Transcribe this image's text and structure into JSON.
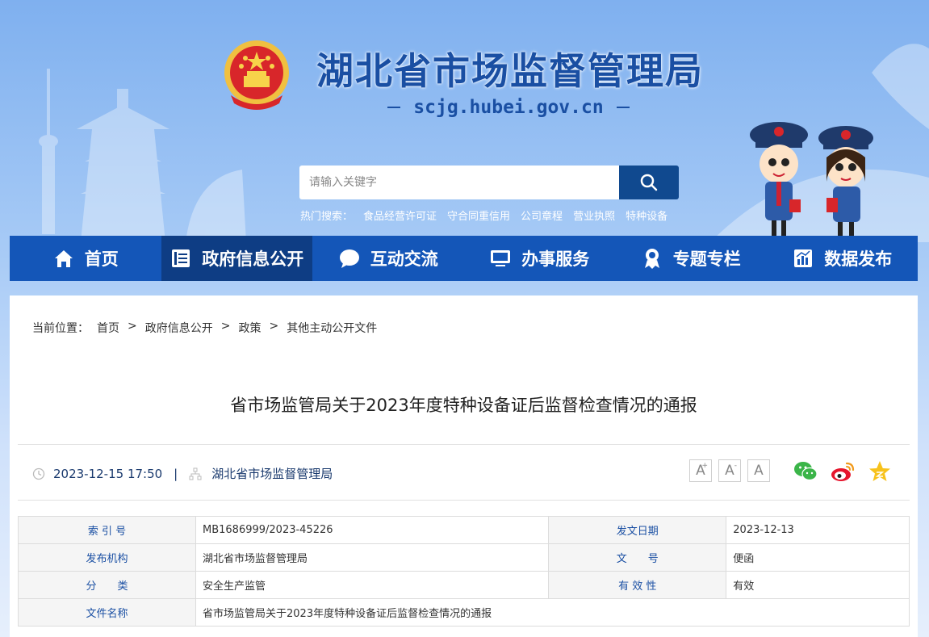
{
  "header": {
    "site_title": "湖北省市场监督管理局",
    "site_domain": "scjg.hubei.gov.cn"
  },
  "search": {
    "placeholder": "请输入关键字",
    "hot_label": "热门搜索：",
    "hot_terms": [
      "食品经营许可证",
      "守合同重信用",
      "公司章程",
      "营业执照",
      "特种设备"
    ]
  },
  "nav": {
    "items": [
      {
        "label": "首页",
        "icon": "home-icon"
      },
      {
        "label": "政府信息公开",
        "icon": "document-icon"
      },
      {
        "label": "互动交流",
        "icon": "chat-bubble-icon"
      },
      {
        "label": "办事服务",
        "icon": "monitor-icon"
      },
      {
        "label": "专题专栏",
        "icon": "award-icon"
      },
      {
        "label": "数据发布",
        "icon": "chart-icon"
      }
    ],
    "active_index": 1
  },
  "breadcrumb": {
    "prefix": "当前位置：",
    "items": [
      "首页",
      "政府信息公开",
      "政策",
      "其他主动公开文件"
    ],
    "separator": ">"
  },
  "article": {
    "title": "省市场监管局关于2023年度特种设备证后监督检查情况的通报",
    "datetime": "2023-12-15 17:50",
    "separator": "|",
    "publisher": "湖北省市场监督管理局"
  },
  "font_size_controls": {
    "increase": "A",
    "decrease": "A",
    "reset": "A"
  },
  "share": [
    "wechat-icon",
    "weibo-icon",
    "favorite-star-icon"
  ],
  "info_table": {
    "index_label": "索 引 号",
    "index_value": "MB1686999/2023-45226",
    "date_label": "发文日期",
    "date_value": "2023-12-13",
    "org_label": "发布机构",
    "org_value": "湖北省市场监督管理局",
    "docno_label": "文　　号",
    "docno_value": "便函",
    "category_label": "分　　类",
    "category_value": "安全生产监管",
    "validity_label": "有 效 性",
    "validity_value": "有效",
    "name_label": "文件名称",
    "name_value": "省市场监管局关于2023年度特种设备证后监督检查情况的通报"
  },
  "colors": {
    "nav_bg": "#1456b8",
    "nav_active": "#0e3d84",
    "title_blue": "#1a4fa3",
    "search_btn": "#10498f"
  }
}
